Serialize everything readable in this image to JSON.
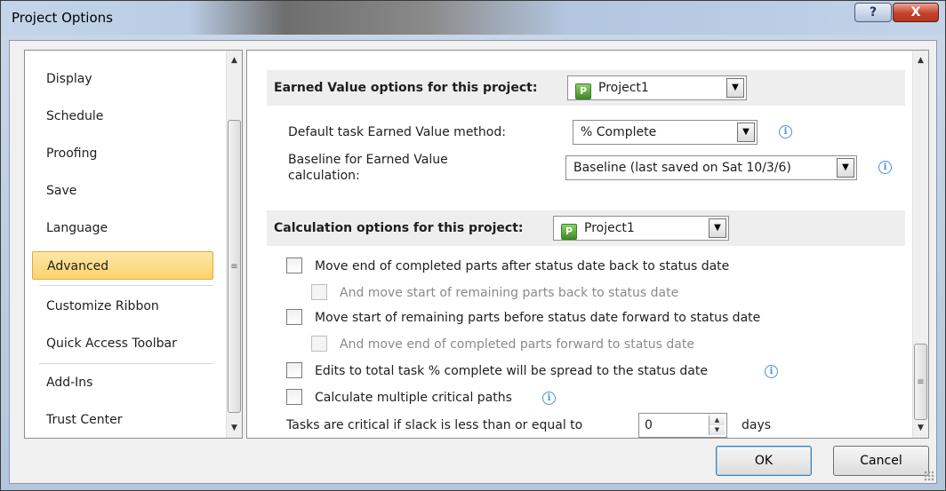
{
  "window": {
    "title": "Project Options",
    "help_label": "?",
    "close_label": "X"
  },
  "nav": {
    "items": [
      {
        "label": "Display"
      },
      {
        "label": "Schedule"
      },
      {
        "label": "Proofing"
      },
      {
        "label": "Save"
      },
      {
        "label": "Language"
      },
      {
        "label": "Advanced"
      },
      {
        "label": "Customize Ribbon"
      },
      {
        "label": "Quick Access Toolbar"
      },
      {
        "label": "Add-Ins"
      },
      {
        "label": "Trust Center"
      }
    ],
    "selected": "Advanced"
  },
  "earned_value": {
    "header": "Earned Value options for this project:",
    "project_value": "Project1",
    "method_label": "Default task Earned Value method:",
    "method_value": "% Complete",
    "baseline_label_line1": "Baseline for Earned Value",
    "baseline_label_line2": "calculation:",
    "baseline_value": "Baseline  (last saved on Sat 10/3/6)"
  },
  "calculation": {
    "header": "Calculation options for this project:",
    "project_value": "Project1",
    "options": [
      {
        "label": "Move end of completed parts after status date back to status date",
        "checked": false,
        "enabled": true
      },
      {
        "label": "And move start of remaining parts back to status date",
        "checked": false,
        "enabled": false
      },
      {
        "label": "Move start of remaining parts before status date forward to status date",
        "checked": false,
        "enabled": true
      },
      {
        "label": "And move end of completed parts forward to status date",
        "checked": false,
        "enabled": false
      },
      {
        "label": "Edits to total task % complete will be spread to the status date",
        "checked": false,
        "enabled": true
      },
      {
        "label": "Calculate multiple critical paths",
        "checked": false,
        "enabled": true
      }
    ],
    "slack_label": "Tasks are critical if slack is less than or equal to",
    "slack_value": "0",
    "slack_unit": "days"
  },
  "buttons": {
    "ok": "OK",
    "cancel": "Cancel"
  },
  "icons": {
    "info": "i",
    "project": "P"
  }
}
